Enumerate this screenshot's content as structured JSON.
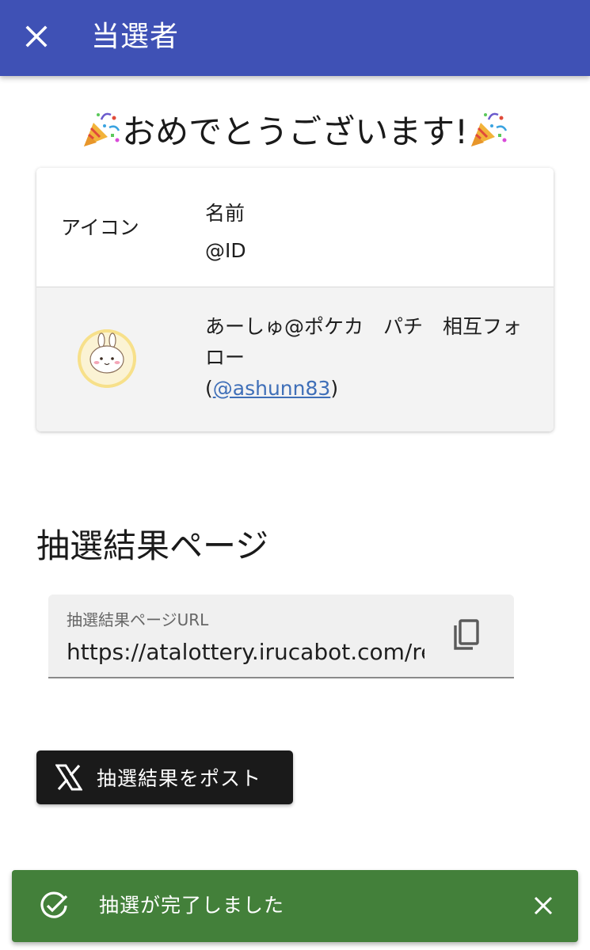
{
  "appbar": {
    "title": "当選者",
    "close_icon": "close-icon",
    "color": "#3f51b5"
  },
  "headline": {
    "text": "おめでとうございます!",
    "icon": "party-popper-icon"
  },
  "winner_table": {
    "headers": {
      "icon": "アイコン",
      "name": "名前",
      "id": "@ID"
    },
    "rows": [
      {
        "avatar": "avatar-icon",
        "name": "あーしゅ@ポケカ　パチ　相互フォロー",
        "id_prefix": "(",
        "id": "@ashunn83",
        "id_suffix": ")"
      }
    ]
  },
  "result": {
    "section_title": "抽選結果ページ",
    "url_label": "抽選結果ページURL",
    "url_value": "https://atalottery.irucabot.com/re",
    "copy_icon": "copy-icon"
  },
  "post_button": {
    "label": "抽選結果をポスト",
    "icon": "x-logo-icon"
  },
  "snackbar": {
    "message": "抽選が完了しました",
    "icon": "check-circle-icon",
    "dismiss_icon": "close-icon",
    "color": "#43803a"
  }
}
